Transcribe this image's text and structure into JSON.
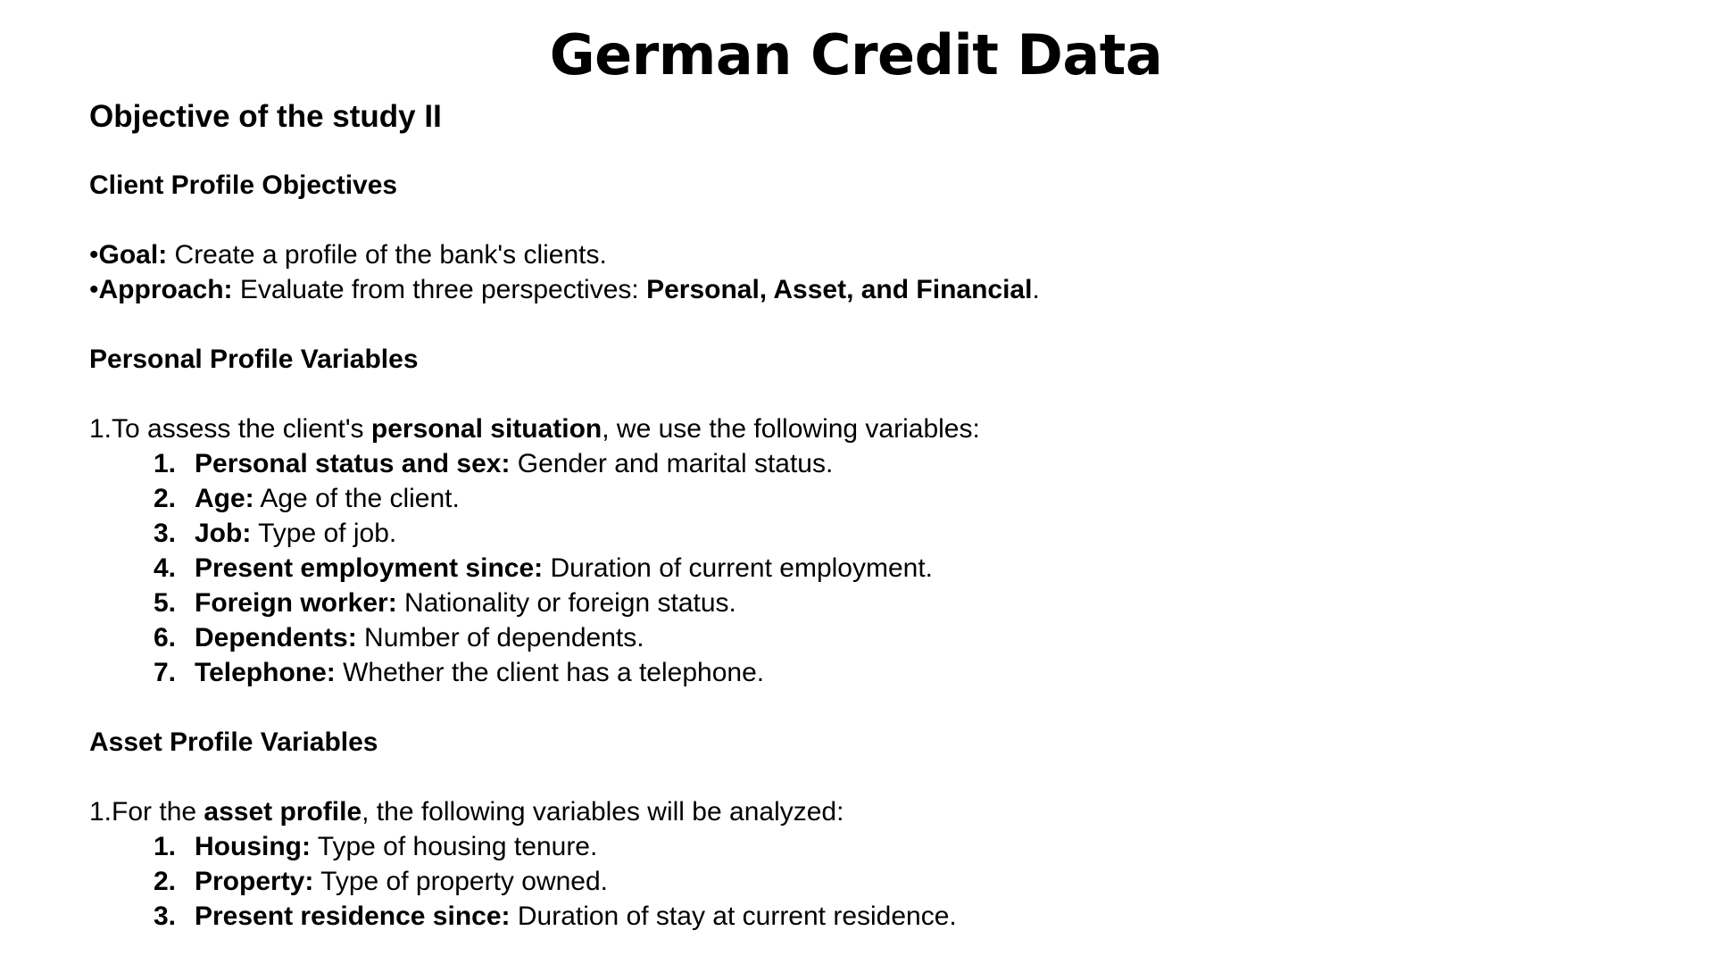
{
  "slide": {
    "title": "German Credit Data",
    "subtitle": "Objective of the study II"
  },
  "client_profile": {
    "heading": "Client Profile Objectives",
    "goal": {
      "bullet": "•",
      "label": "Goal:",
      "text": " Create a profile of the bank's clients."
    },
    "approach": {
      "bullet": "•",
      "label": "Approach:",
      "text": " Evaluate from three perspectives: ",
      "emphasis": "Personal, Asset, and Financial",
      "end": "."
    }
  },
  "personal_profile": {
    "heading": "Personal Profile Variables",
    "intro_prefix": "1.To assess the client's ",
    "intro_emphasis": "personal situation",
    "intro_suffix": ", we use the following variables:",
    "items": [
      {
        "num": "1.",
        "label": "Personal status and sex:",
        "text": " Gender and marital status."
      },
      {
        "num": "2.",
        "label": "Age:",
        "text": " Age of the client."
      },
      {
        "num": "3.",
        "label": "Job:",
        "text": " Type of job."
      },
      {
        "num": "4.",
        "label": "Present employment since:",
        "text": " Duration of current employment."
      },
      {
        "num": "5.",
        "label": "Foreign worker:",
        "text": " Nationality or foreign status."
      },
      {
        "num": "6.",
        "label": "Dependents:",
        "text": " Number of dependents."
      },
      {
        "num": "7.",
        "label": "Telephone:",
        "text": " Whether the client has a telephone."
      }
    ]
  },
  "asset_profile": {
    "heading": "Asset Profile Variables",
    "intro_prefix": "1.For the ",
    "intro_emphasis": "asset profile",
    "intro_suffix": ", the following variables will be analyzed:",
    "items": [
      {
        "num": "1.",
        "label": "Housing:",
        "text": " Type of housing tenure."
      },
      {
        "num": "2.",
        "label": "Property:",
        "text": " Type of property owned."
      },
      {
        "num": "3.",
        "label": "Present residence since:",
        "text": " Duration of stay at current residence."
      }
    ]
  }
}
